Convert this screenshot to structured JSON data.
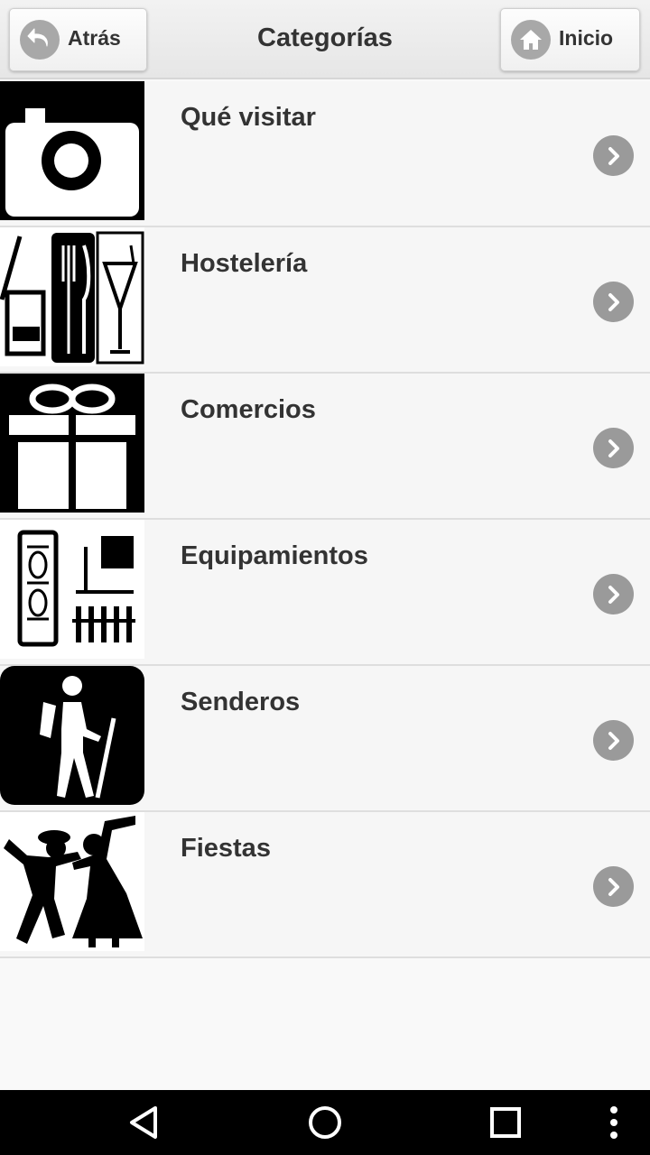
{
  "header": {
    "title": "Categorías",
    "back_label": "Atrás",
    "home_label": "Inicio"
  },
  "categories": [
    {
      "label": "Qué visitar",
      "icon": "camera-icon"
    },
    {
      "label": "Hostelería",
      "icon": "hospitality-icon"
    },
    {
      "label": "Comercios",
      "icon": "gift-icon"
    },
    {
      "label": "Equipamientos",
      "icon": "facilities-icon"
    },
    {
      "label": "Senderos",
      "icon": "hiker-icon"
    },
    {
      "label": "Fiestas",
      "icon": "dancers-icon"
    }
  ],
  "navbar": {
    "icons": [
      "back-triangle-icon",
      "home-circle-icon",
      "recents-square-icon",
      "overflow-menu-icon"
    ]
  },
  "colors": {
    "background": "#f9f9f9",
    "header": "#e9e9e9",
    "text": "#333333",
    "chevron": "#9a9a9a",
    "navbar": "#000000"
  }
}
